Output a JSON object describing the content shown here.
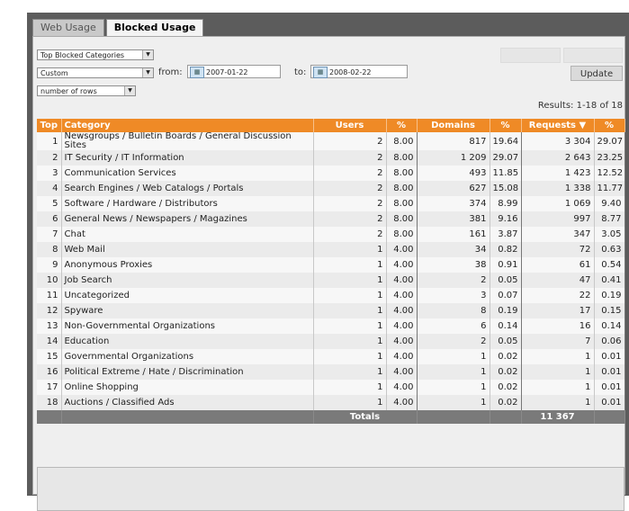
{
  "tabs": [
    {
      "label": "Web Usage",
      "active": false
    },
    {
      "label": "Blocked Usage",
      "active": true
    }
  ],
  "filters": {
    "report_select": "Top Blocked Categories",
    "period_select": "Custom",
    "from_label": "from:",
    "from_date": "2007-01-22",
    "to_label": "to:",
    "to_date": "2008-02-22",
    "rows_select": "number of rows",
    "update_label": "Update"
  },
  "results_text": "Results: 1-18 of 18",
  "table": {
    "headers": {
      "top": "Top",
      "category": "Category",
      "users": "Users",
      "users_pct": "%",
      "domains": "Domains",
      "domains_pct": "%",
      "requests": "Requests",
      "requests_pct": "%"
    },
    "sort_arrow": "▼",
    "rows": [
      [
        "1",
        "Newsgroups / Bulletin Boards / General Discussion Sites",
        "2",
        "8.00",
        "817",
        "19.64",
        "3 304",
        "29.07"
      ],
      [
        "2",
        "IT Security / IT Information",
        "2",
        "8.00",
        "1 209",
        "29.07",
        "2 643",
        "23.25"
      ],
      [
        "3",
        "Communication Services",
        "2",
        "8.00",
        "493",
        "11.85",
        "1 423",
        "12.52"
      ],
      [
        "4",
        "Search Engines / Web Catalogs / Portals",
        "2",
        "8.00",
        "627",
        "15.08",
        "1 338",
        "11.77"
      ],
      [
        "5",
        "Software / Hardware / Distributors",
        "2",
        "8.00",
        "374",
        "8.99",
        "1 069",
        "9.40"
      ],
      [
        "6",
        "General News / Newspapers / Magazines",
        "2",
        "8.00",
        "381",
        "9.16",
        "997",
        "8.77"
      ],
      [
        "7",
        "Chat",
        "2",
        "8.00",
        "161",
        "3.87",
        "347",
        "3.05"
      ],
      [
        "8",
        "Web Mail",
        "1",
        "4.00",
        "34",
        "0.82",
        "72",
        "0.63"
      ],
      [
        "9",
        "Anonymous Proxies",
        "1",
        "4.00",
        "38",
        "0.91",
        "61",
        "0.54"
      ],
      [
        "10",
        "Job Search",
        "1",
        "4.00",
        "2",
        "0.05",
        "47",
        "0.41"
      ],
      [
        "11",
        "Uncategorized",
        "1",
        "4.00",
        "3",
        "0.07",
        "22",
        "0.19"
      ],
      [
        "12",
        "Spyware",
        "1",
        "4.00",
        "8",
        "0.19",
        "17",
        "0.15"
      ],
      [
        "13",
        "Non-Governmental Organizations",
        "1",
        "4.00",
        "6",
        "0.14",
        "16",
        "0.14"
      ],
      [
        "14",
        "Education",
        "1",
        "4.00",
        "2",
        "0.05",
        "7",
        "0.06"
      ],
      [
        "15",
        "Governmental Organizations",
        "1",
        "4.00",
        "1",
        "0.02",
        "1",
        "0.01"
      ],
      [
        "16",
        "Political Extreme / Hate / Discrimination",
        "1",
        "4.00",
        "1",
        "0.02",
        "1",
        "0.01"
      ],
      [
        "17",
        "Online Shopping",
        "1",
        "4.00",
        "1",
        "0.02",
        "1",
        "0.01"
      ],
      [
        "18",
        "Auctions / Classified Ads",
        "1",
        "4.00",
        "1",
        "0.02",
        "1",
        "0.01"
      ]
    ],
    "totals_label": "Totals",
    "totals_requests": "11 367"
  },
  "colors": {
    "header_bg": "#ef8a26",
    "frame_bg": "#5c5c5c",
    "totals_bg": "#7a7a7a"
  },
  "icons": {
    "calendar": "calendar-icon",
    "dropdown": "chevron-down-icon",
    "sort": "sort-desc-icon"
  }
}
